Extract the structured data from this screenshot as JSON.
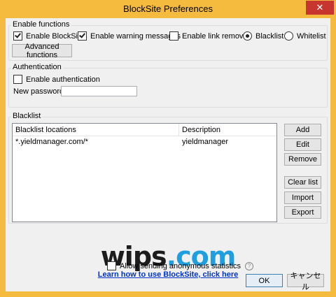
{
  "window": {
    "title": "BlockSite Preferences",
    "close_glyph": "✕"
  },
  "enable_functions": {
    "legend": "Enable functions",
    "enable_blocksite": {
      "label": "Enable BlockSite",
      "checked": true
    },
    "enable_warning": {
      "label": "Enable warning messages",
      "checked": true
    },
    "enable_link_removal": {
      "label": "Enable link removal",
      "checked": false
    },
    "mode_blacklist": {
      "label": "Blacklist",
      "selected": true
    },
    "mode_whitelist": {
      "label": "Whitelist",
      "selected": false
    },
    "advanced_button": "Advanced functions"
  },
  "authentication": {
    "legend": "Authentication",
    "enable_auth": {
      "label": "Enable authentication",
      "checked": false
    },
    "password_label": "New password",
    "password_value": ""
  },
  "blacklist": {
    "legend": "Blacklist",
    "columns": [
      "Blacklist locations",
      "Description"
    ],
    "rows": [
      {
        "location": "*.yieldmanager.com/*",
        "description": "yieldmanager"
      }
    ],
    "buttons": {
      "add": "Add",
      "edit": "Edit",
      "remove": "Remove",
      "clear": "Clear list",
      "import": "Import",
      "export": "Export"
    }
  },
  "footer": {
    "logo_main": "wips",
    "logo_suffix": ".com",
    "link_text": "Learn how to use BlockSite, click here",
    "stats_label": "Allow sending anonymous statistics",
    "stats_checked": false,
    "help_glyph": "?",
    "ok_button": "OK",
    "cancel_button": "キャンセル"
  }
}
